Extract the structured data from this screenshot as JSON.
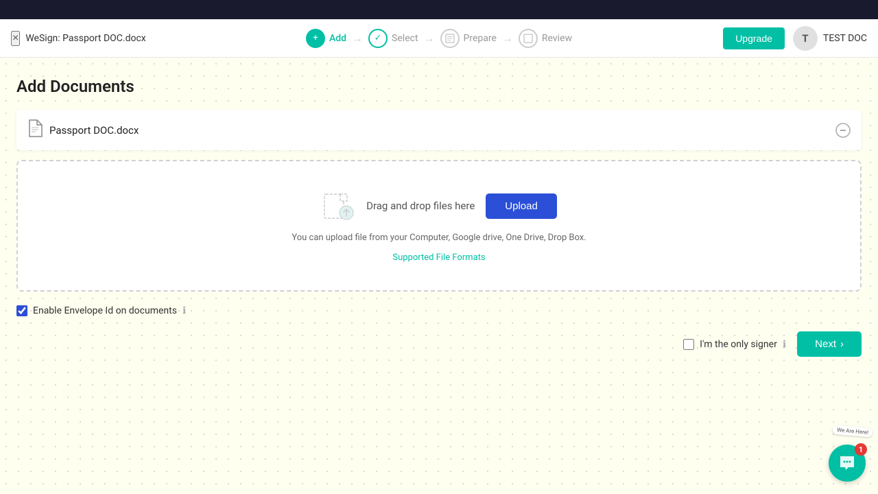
{
  "topBar": {},
  "header": {
    "closeLabel": "×",
    "docTitle": "WeSign: Passport DOC.docx",
    "steps": [
      {
        "id": "add",
        "label": "Add",
        "state": "active",
        "icon": "+"
      },
      {
        "id": "select",
        "label": "Select",
        "state": "completed",
        "icon": "✓"
      },
      {
        "id": "prepare",
        "label": "Prepare",
        "state": "inactive",
        "icon": "▣"
      },
      {
        "id": "review",
        "label": "Review",
        "state": "inactive",
        "icon": "▢"
      }
    ],
    "upgradeLabel": "Upgrade",
    "userInitial": "T",
    "userName": "TEST DOC"
  },
  "main": {
    "pageTitle": "Add Documents",
    "document": {
      "name": "Passport DOC.docx"
    },
    "uploadArea": {
      "dragText": "Drag and drop files here",
      "uploadButton": "Upload",
      "subText": "You can upload file from your Computer, Google drive, One Drive, Drop Box.",
      "supportedLink": "Supported File Formats"
    },
    "envelopeId": {
      "label": "Enable Envelope Id on documents",
      "checked": true
    },
    "signerRow": {
      "label": "I'm the only signer",
      "checked": false
    },
    "nextButton": "Next"
  },
  "chat": {
    "weAreHere": "We Are Here!",
    "badgeCount": "1"
  }
}
